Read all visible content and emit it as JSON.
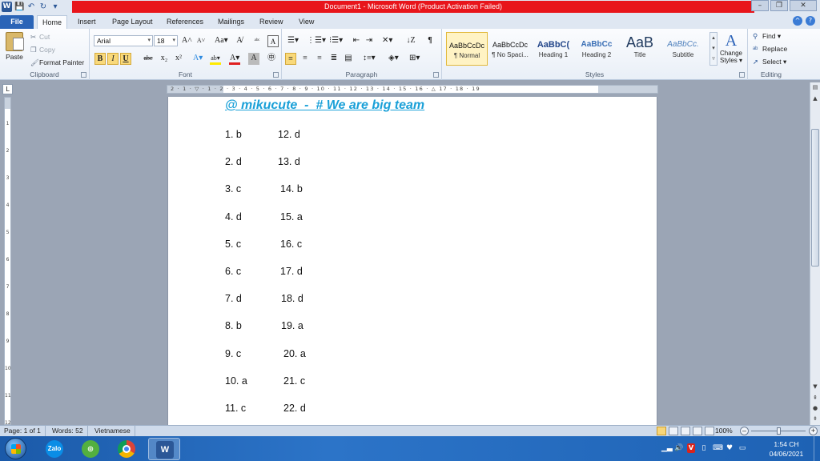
{
  "window": {
    "title": "Document1  -  Microsoft Word (Product Activation Failed)",
    "quick_access": {
      "logo": "W",
      "save": "💾",
      "undo": "↶",
      "redo": "↻",
      "customize": "▾"
    },
    "controls": {
      "minimize": "–",
      "restore": "❐",
      "close": "✕"
    }
  },
  "tabs": [
    {
      "label": "File"
    },
    {
      "label": "Home"
    },
    {
      "label": "Insert"
    },
    {
      "label": "Page Layout"
    },
    {
      "label": "References"
    },
    {
      "label": "Mailings"
    },
    {
      "label": "Review"
    },
    {
      "label": "View"
    }
  ],
  "help": {
    "minimize_ribbon": "^",
    "help": "?"
  },
  "ribbon": {
    "clipboard": {
      "label": "Clipboard",
      "paste": "Paste",
      "cut": "Cut",
      "copy": "Copy",
      "format_painter": "Format Painter"
    },
    "font": {
      "label": "Font",
      "family": "Arial",
      "size": "18",
      "grow": "A˄",
      "shrink": "A˅",
      "change_case": "Aa▾",
      "clear": "A̸",
      "bold": "B",
      "italic": "I",
      "underline": "U",
      "strike": "abc",
      "subscript": "x₂",
      "superscript": "x²",
      "effects": "A▾",
      "highlight": "ab▾",
      "color": "A▾"
    },
    "paragraph": {
      "label": "Paragraph",
      "pilcrow": "¶"
    },
    "styles": {
      "label": "Styles",
      "items": [
        {
          "sample": "AaBbCcDc",
          "name": "¶ Normal"
        },
        {
          "sample": "AaBbCcDc",
          "name": "¶ No Spaci..."
        },
        {
          "sample": "AaBbC(",
          "name": "Heading 1"
        },
        {
          "sample": "AaBbCc",
          "name": "Heading 2"
        },
        {
          "sample": "AaB",
          "name": "Title"
        },
        {
          "sample": "AaBbCc.",
          "name": "Subtitle"
        }
      ],
      "change_styles": "Change Styles ▾"
    },
    "editing": {
      "label": "Editing",
      "find": "Find ▾",
      "replace": "Replace",
      "select": "Select ▾"
    }
  },
  "ruler": {
    "corner": "L",
    "numbers": "2 · 1 · ▽ · 1 · 2 · 3 · 4 · 5 · 6 · 7 · 8 · 9 · 10 · 11 · 12 · 13 · 14 · 15 · 16 · △ 17 · 18 · 19",
    "vnumbers": "1 2 3 4 5 6 7 8 9 10 11 12"
  },
  "document": {
    "heading": "@ mikucute  -  # We are big team",
    "answers": [
      {
        "left": "1. b",
        "right": "12. d"
      },
      {
        "left": "2. d",
        "right": "13. d"
      },
      {
        "left": "3. c",
        "right": "14. b"
      },
      {
        "left": "4. d",
        "right": "15. a"
      },
      {
        "left": "5. c",
        "right": "16. c"
      },
      {
        "left": "6. c",
        "right": "17. d"
      },
      {
        "left": "7. d",
        "right": "18. d"
      },
      {
        "left": "8. b",
        "right": "19. a"
      },
      {
        "left": "9. c",
        "right": "20. a"
      },
      {
        "left": "10. a",
        "right": "21. c"
      },
      {
        "left": "11. c",
        "right": "22. d"
      }
    ]
  },
  "status": {
    "page": "Page: 1 of 1",
    "words": "Words: 52",
    "language": "Vietnamese",
    "zoom": "100%",
    "zoom_minus": "–",
    "zoom_plus": "+"
  },
  "taskbar": {
    "apps": [
      {
        "name": "Zalo",
        "label": "Zalo"
      },
      {
        "name": "green-app",
        "label": "◎"
      },
      {
        "name": "Chrome",
        "label": ""
      },
      {
        "name": "Word",
        "label": "W"
      }
    ],
    "tray": {
      "signal": "▁▃",
      "volume": "🔊",
      "v_badge": "V",
      "battery": "▯",
      "keyboard": "⌨",
      "shield": "♥",
      "chat": "▭"
    },
    "time": "1:54 CH",
    "date": "04/06/2021"
  }
}
